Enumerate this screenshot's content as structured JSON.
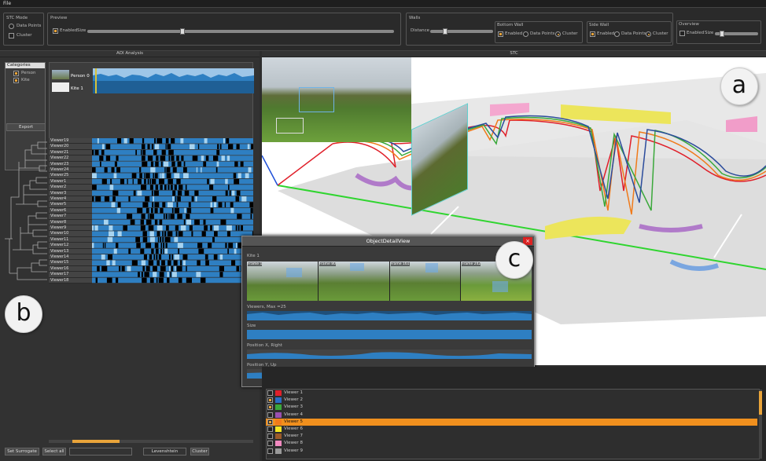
{
  "menu": {
    "file": "File"
  },
  "toolbar": {
    "stc_mode": {
      "title": "STC Mode",
      "data_points": "Data Points",
      "cluster": "Cluster"
    },
    "preview": {
      "title": "Preview",
      "enabled": "Enabled",
      "size": "Size"
    },
    "walls": {
      "title": "Walls",
      "distance": "Distance",
      "bottom_wall": {
        "title": "Bottom Wall",
        "enabled": "Enabled",
        "data_points": "Data Points",
        "cluster": "Cluster"
      },
      "side_wall": {
        "title": "Side Wall",
        "enabled": "Enabled",
        "data_points": "Data Points",
        "cluster": "Cluster"
      }
    },
    "overview": {
      "title": "Overview",
      "enabled": "Enabled",
      "size": "Size"
    }
  },
  "aoi_panel": {
    "title": "AOI Analysis",
    "categories_title": "Categories",
    "categories": [
      "Person",
      "Kite"
    ],
    "tracks": [
      "Person 0",
      "Kite 1"
    ],
    "export": "Export",
    "viewers": [
      "Viewer19",
      "Viewer20",
      "Viewer21",
      "Viewer22",
      "Viewer23",
      "Viewer24",
      "Viewer25",
      "Viewer1",
      "Viewer2",
      "Viewer3",
      "Viewer4",
      "Viewer5",
      "Viewer6",
      "Viewer7",
      "Viewer8",
      "Viewer9",
      "Viewer10",
      "Viewer11",
      "Viewer12",
      "Viewer13",
      "Viewer14",
      "Viewer15",
      "Viewer16",
      "Viewer17",
      "Viewer18"
    ],
    "buttons": {
      "set_surrogate": "Set Surrogate",
      "select_all": "Select all",
      "metric": "Levenshtein",
      "cluster": "Cluster"
    }
  },
  "stc_panel": {
    "title": "STC"
  },
  "labels": {
    "a": "a",
    "b": "b",
    "c": "c"
  },
  "object_detail": {
    "title": "ObjectDetailView",
    "object": "Kite 1",
    "frames": [
      "Frame 1",
      "Frame 80",
      "Frame 161",
      "Frame 242"
    ],
    "tracks": [
      "Viewers, Max =25",
      "Size",
      "Position X, Right",
      "Position Y, Up"
    ]
  },
  "viewer_list": [
    {
      "name": "Viewer 1",
      "color": "#e0202a",
      "checked": false
    },
    {
      "name": "Viewer 2",
      "color": "#2b6cc4",
      "checked": true
    },
    {
      "name": "Viewer 3",
      "color": "#3aa83a",
      "checked": true
    },
    {
      "name": "Viewer 4",
      "color": "#9a50b0",
      "checked": false
    },
    {
      "name": "Viewer 5",
      "color": "#f07a1a",
      "checked": true,
      "selected": true
    },
    {
      "name": "Viewer 6",
      "color": "#f5e623",
      "checked": false
    },
    {
      "name": "Viewer 7",
      "color": "#9b5a2a",
      "checked": false
    },
    {
      "name": "Viewer 8",
      "color": "#f28ac0",
      "checked": false
    },
    {
      "name": "Viewer 9",
      "color": "#999999",
      "checked": false
    }
  ],
  "colors": {
    "accent": "#e9a43a",
    "selection": "#f0901e",
    "series_blue": "#2e7fc2"
  }
}
